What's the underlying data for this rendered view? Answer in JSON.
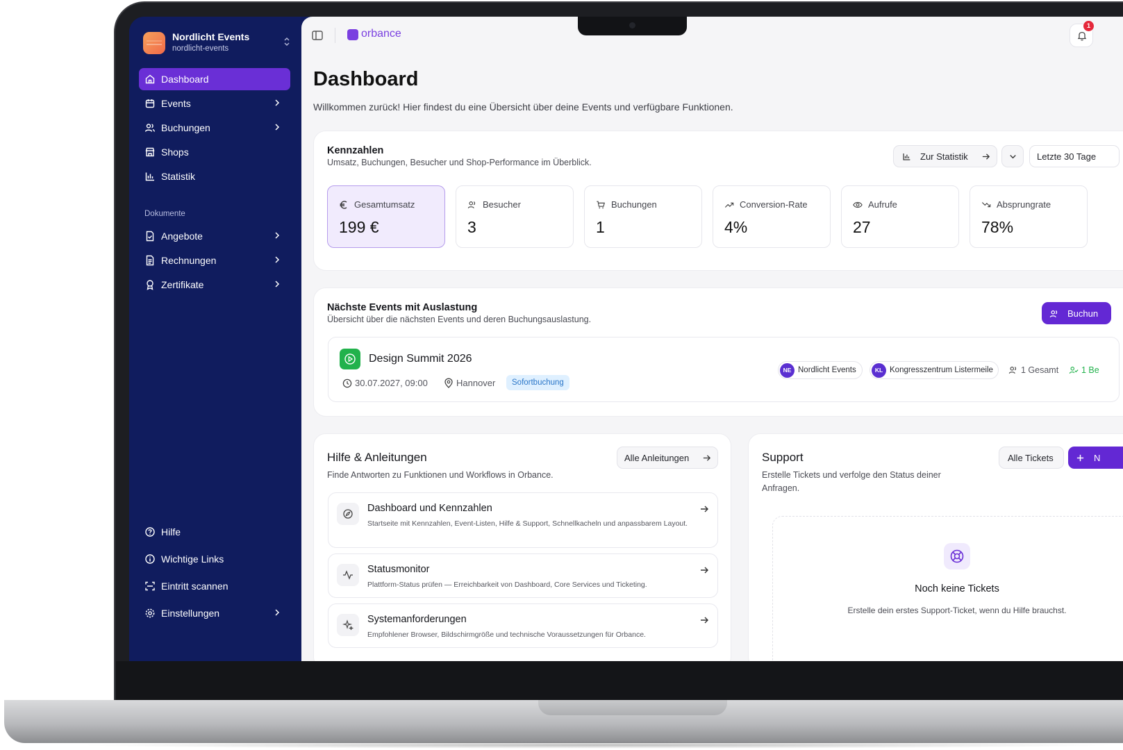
{
  "brand": {
    "name": "Nordlicht Events",
    "slug": "nordlicht-events"
  },
  "sidebar": {
    "items": [
      {
        "label": "Dashboard",
        "icon": "home-icon",
        "active": true
      },
      {
        "label": "Events",
        "icon": "calendar-icon",
        "chevron": true
      },
      {
        "label": "Buchungen",
        "icon": "users-icon",
        "chevron": true
      },
      {
        "label": "Shops",
        "icon": "store-icon"
      },
      {
        "label": "Statistik",
        "icon": "bar-chart-icon"
      }
    ],
    "section_label": "Dokumente",
    "doc_items": [
      {
        "label": "Angebote",
        "icon": "file-check-icon",
        "chevron": true
      },
      {
        "label": "Rechnungen",
        "icon": "file-text-icon",
        "chevron": true
      },
      {
        "label": "Zertifikate",
        "icon": "award-icon",
        "chevron": true
      }
    ],
    "bottom_items": [
      {
        "label": "Hilfe",
        "icon": "help-circle-icon"
      },
      {
        "label": "Wichtige Links",
        "icon": "info-icon"
      },
      {
        "label": "Eintritt scannen",
        "icon": "scan-icon"
      },
      {
        "label": "Einstellungen",
        "icon": "settings-icon",
        "chevron": true
      }
    ]
  },
  "topbar": {
    "logo_text": "orbance",
    "notification_count": "1"
  },
  "page": {
    "title": "Dashboard",
    "subtitle": "Willkommen zurück! Hier findest du eine Übersicht über deine Events und verfügbare Funktionen."
  },
  "kpis": {
    "title": "Kennzahlen",
    "subtitle": "Umsatz, Buchungen, Besucher und Shop-Performance im Überblick.",
    "stats_button": "Zur Statistik",
    "range_select": "Letzte 30 Tage",
    "items": [
      {
        "label": "Gesamtumsatz",
        "value": "199 €",
        "icon": "euro-icon",
        "selected": true
      },
      {
        "label": "Besucher",
        "value": "3",
        "icon": "users-icon"
      },
      {
        "label": "Buchungen",
        "value": "1",
        "icon": "cart-icon"
      },
      {
        "label": "Conversion-Rate",
        "value": "4%",
        "icon": "trending-up-icon"
      },
      {
        "label": "Aufrufe",
        "value": "27",
        "icon": "eye-icon"
      },
      {
        "label": "Absprungrate",
        "value": "78%",
        "icon": "trending-down-icon"
      }
    ]
  },
  "events": {
    "title": "Nächste Events mit Auslastung",
    "subtitle": "Übersicht über die nächsten Events und deren Buchungsauslastung.",
    "action_button": "Buchun",
    "item": {
      "name": "Design Summit 2026",
      "datetime": "30.07.2027, 09:00",
      "location": "Hannover",
      "tag": "Sofortbuchung",
      "organizer": {
        "initials": "NE",
        "name": "Nordlicht Events"
      },
      "venue": {
        "initials": "KL",
        "name": "Kongresszentrum Listermeile"
      },
      "total": "1 Gesamt",
      "booked": "1 Be"
    }
  },
  "help": {
    "title": "Hilfe & Anleitungen",
    "subtitle": "Finde Antworten zu Funktionen und Workflows in Orbance.",
    "all_button": "Alle Anleitungen",
    "items": [
      {
        "title": "Dashboard und Kennzahlen",
        "desc": "Startseite mit Kennzahlen, Event-Listen, Hilfe & Support, Schnellkacheln und anpassbarem Layout.",
        "icon": "compass-icon"
      },
      {
        "title": "Statusmonitor",
        "desc": "Plattform-Status prüfen — Erreichbarkeit von Dashboard, Core Services und Ticketing.",
        "icon": "activity-icon"
      },
      {
        "title": "Systemanforderungen",
        "desc": "Empfohlener Browser, Bildschirmgröße und technische Voraussetzungen für Orbance.",
        "icon": "sparkles-icon"
      }
    ]
  },
  "support": {
    "title": "Support",
    "subtitle_line1": "Erstelle Tickets und verfolge den Status deiner",
    "subtitle_line2": "Anfragen.",
    "all_button": "Alle Tickets",
    "new_button": "N",
    "empty_title": "Noch keine Tickets",
    "empty_sub": "Erstelle dein erstes Support-Ticket, wenn du Hilfe brauchst."
  },
  "colors": {
    "sidebar": "#101c5e",
    "accent": "#6328d4",
    "active_nav": "#6a2fd6",
    "success": "#22b24c"
  }
}
